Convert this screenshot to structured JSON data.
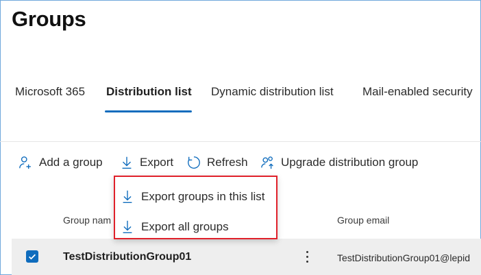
{
  "page": {
    "title": "Groups"
  },
  "tabs": [
    {
      "label": "Microsoft 365",
      "active": false
    },
    {
      "label": "Distribution list",
      "active": true
    },
    {
      "label": "Dynamic distribution list",
      "active": false
    },
    {
      "label": "Mail-enabled security",
      "active": false
    }
  ],
  "toolbar": {
    "add_group": "Add a group",
    "export": "Export",
    "refresh": "Refresh",
    "upgrade": "Upgrade distribution group"
  },
  "export_menu": {
    "items": [
      {
        "label": "Export groups in this list",
        "icon": "download-arrow-icon"
      },
      {
        "label": "Export all groups",
        "icon": "download-arrow-icon"
      }
    ],
    "highlight_color": "#e0202a"
  },
  "table": {
    "columns": {
      "group_name": "Group nam",
      "group_email": "Group email"
    },
    "rows": [
      {
        "selected": true,
        "name": "TestDistributionGroup01",
        "email": "TestDistributionGroup01@lepid"
      }
    ]
  },
  "colors": {
    "accent": "#0f6cbd",
    "selected_row": "#eeeeee"
  }
}
